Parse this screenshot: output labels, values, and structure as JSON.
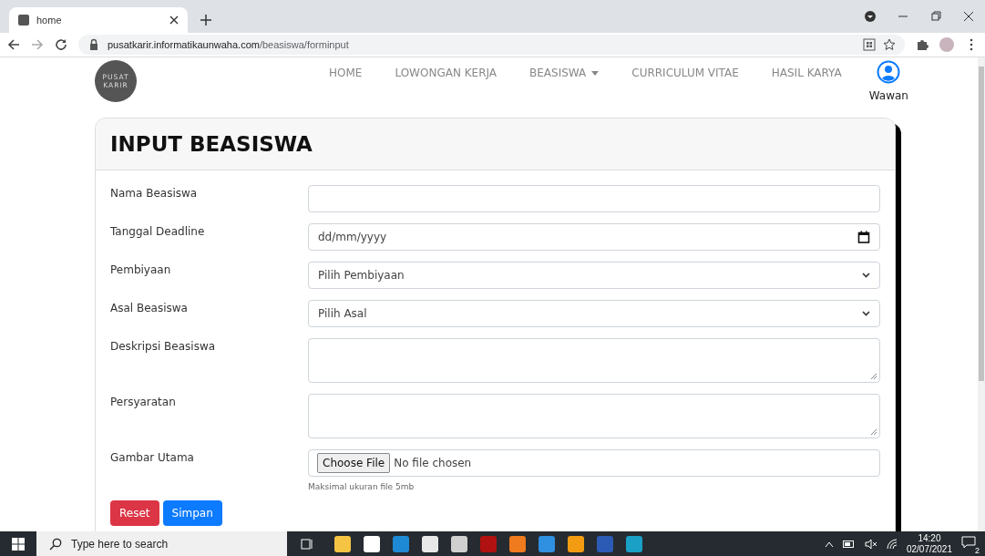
{
  "browser": {
    "tab": {
      "title": "home"
    },
    "url_host": "pusatkarir.informatikaunwaha.com",
    "url_path": "/beasiswa/forminput"
  },
  "navbar": {
    "logo_lines": [
      "PUSAT",
      "KARIR"
    ],
    "items": [
      {
        "label": "HOME",
        "kind": "link"
      },
      {
        "label": "LOWONGAN KERJA",
        "kind": "link"
      },
      {
        "label": "BEASISWA",
        "kind": "dropdown"
      },
      {
        "label": "CURRICULUM VITAE",
        "kind": "link"
      },
      {
        "label": "HASIL KARYA",
        "kind": "link"
      }
    ],
    "user": "Wawan"
  },
  "card": {
    "title": "INPUT BEASISWA",
    "fields": [
      {
        "label": "Nama Beasiswa",
        "kind": "text"
      },
      {
        "label": "Tanggal Deadline",
        "kind": "date",
        "placeholder": "dd/mm/yyyy"
      },
      {
        "label": "Pembiyaan",
        "kind": "select",
        "value": "Pilih Pembiyaan"
      },
      {
        "label": "Asal Beasiswa",
        "kind": "select",
        "value": "Pilih Asal"
      },
      {
        "label": "Deskripsi Beasiswa",
        "kind": "textarea"
      },
      {
        "label": "Persyaratan",
        "kind": "textarea"
      },
      {
        "label": "Gambar Utama",
        "kind": "file",
        "button": "Choose File",
        "value": "No file chosen",
        "help": "Maksimal ukuran file 5mb"
      }
    ],
    "buttons": [
      {
        "label": "Reset",
        "kind": "danger"
      },
      {
        "label": "Simpan",
        "kind": "primary"
      }
    ]
  },
  "taskbar": {
    "search_placeholder": "Type here to search",
    "time": "14:20",
    "date": "02/07/2021",
    "notifications": "2"
  }
}
